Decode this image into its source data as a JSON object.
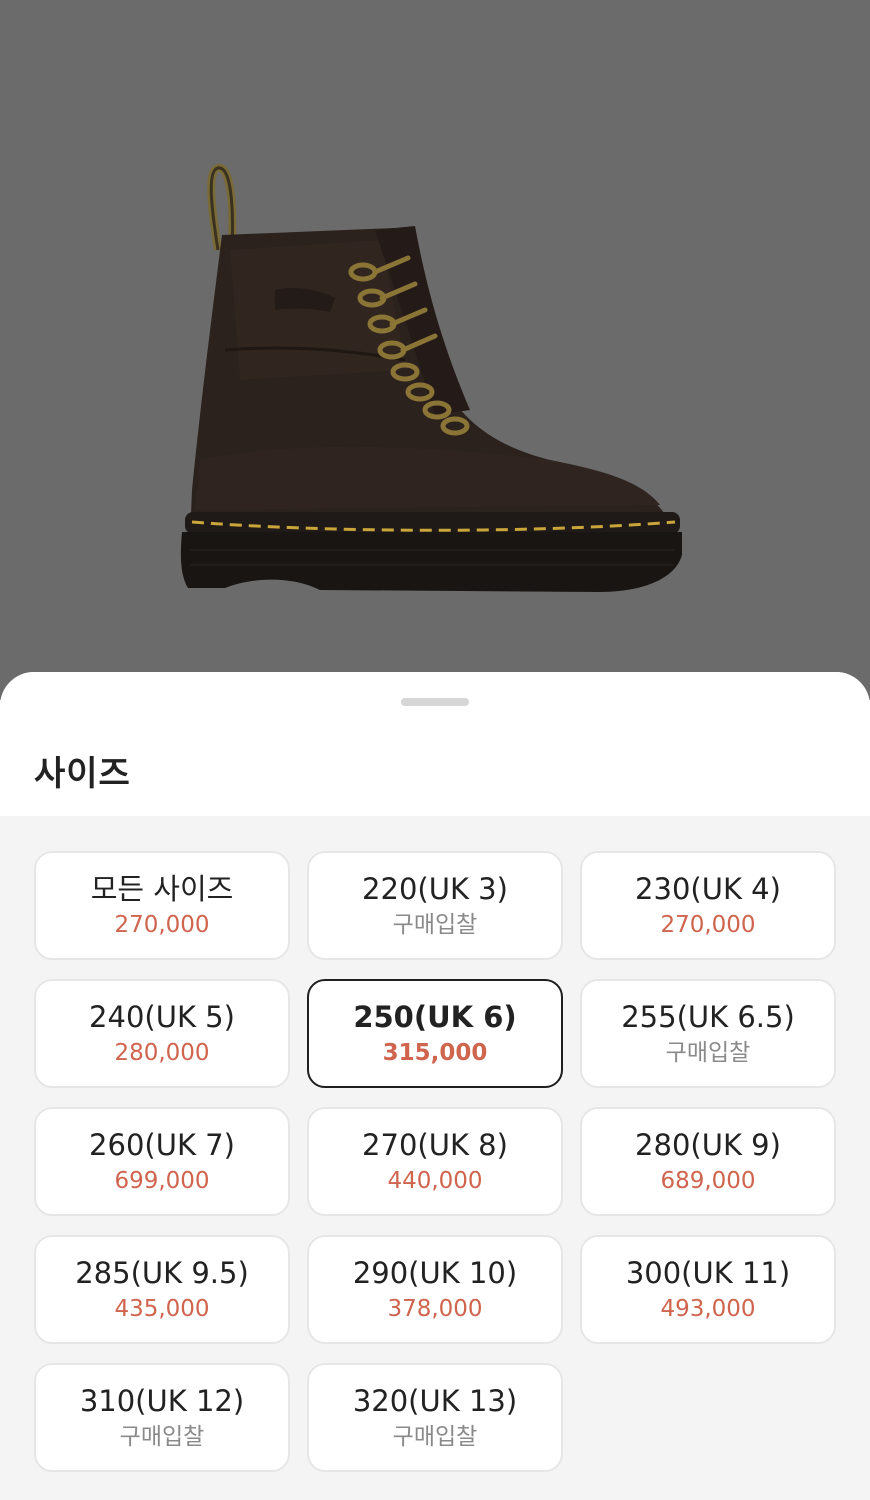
{
  "sheet": {
    "title": "사이즈"
  },
  "product": {
    "image": "boot-icon"
  },
  "sizes": [
    {
      "label": "모든 사이즈",
      "price": "270,000",
      "bid": false,
      "selected": false
    },
    {
      "label": "220(UK 3)",
      "price": "구매입찰",
      "bid": true,
      "selected": false
    },
    {
      "label": "230(UK 4)",
      "price": "270,000",
      "bid": false,
      "selected": false
    },
    {
      "label": "240(UK 5)",
      "price": "280,000",
      "bid": false,
      "selected": false
    },
    {
      "label": "250(UK 6)",
      "price": "315,000",
      "bid": false,
      "selected": true
    },
    {
      "label": "255(UK 6.5)",
      "price": "구매입찰",
      "bid": true,
      "selected": false
    },
    {
      "label": "260(UK 7)",
      "price": "699,000",
      "bid": false,
      "selected": false
    },
    {
      "label": "270(UK 8)",
      "price": "440,000",
      "bid": false,
      "selected": false
    },
    {
      "label": "280(UK 9)",
      "price": "689,000",
      "bid": false,
      "selected": false
    },
    {
      "label": "285(UK 9.5)",
      "price": "435,000",
      "bid": false,
      "selected": false
    },
    {
      "label": "290(UK 10)",
      "price": "378,000",
      "bid": false,
      "selected": false
    },
    {
      "label": "300(UK 11)",
      "price": "493,000",
      "bid": false,
      "selected": false
    },
    {
      "label": "310(UK 12)",
      "price": "구매입찰",
      "bid": true,
      "selected": false
    },
    {
      "label": "320(UK 13)",
      "price": "구매입찰",
      "bid": true,
      "selected": false
    }
  ],
  "colors": {
    "price": "#d0654f",
    "bid": "#8a8a8a",
    "selected_border": "#1f1f1f"
  }
}
